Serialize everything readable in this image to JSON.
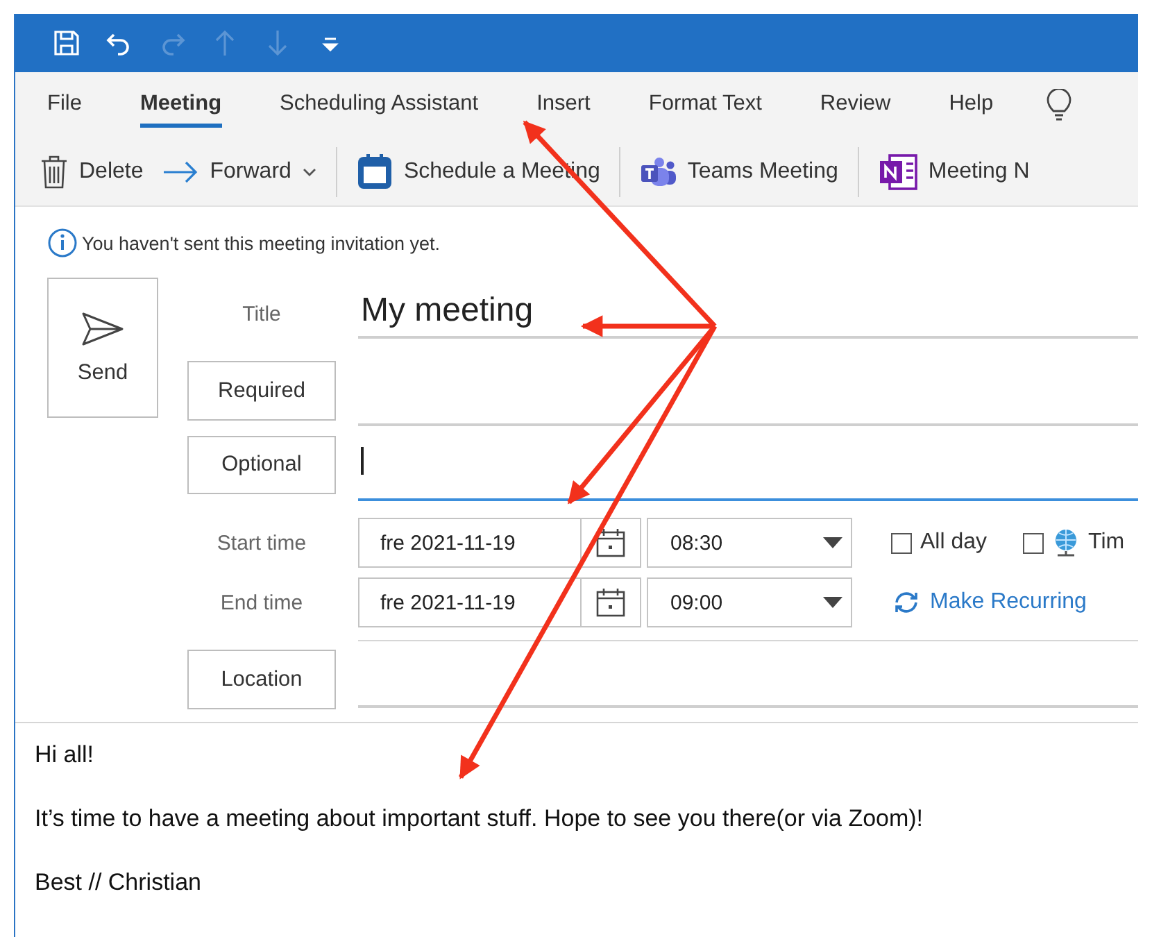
{
  "quick_access": [
    {
      "kind": "save",
      "disabled": false
    },
    {
      "kind": "undo",
      "disabled": false
    },
    {
      "kind": "redo",
      "disabled": true
    },
    {
      "kind": "up",
      "disabled": true
    },
    {
      "kind": "down",
      "disabled": true
    },
    {
      "kind": "customize",
      "disabled": false
    }
  ],
  "tabs": [
    {
      "label": "File",
      "selected": false
    },
    {
      "label": "Meeting",
      "selected": true
    },
    {
      "label": "Scheduling Assistant",
      "selected": false
    },
    {
      "label": "Insert",
      "selected": false
    },
    {
      "label": "Format Text",
      "selected": false
    },
    {
      "label": "Review",
      "selected": false
    },
    {
      "label": "Help",
      "selected": false
    }
  ],
  "commands": [
    {
      "kind": "delete",
      "label": "Delete",
      "dropdown": false
    },
    {
      "kind": "forward",
      "label": "Forward",
      "dropdown": true
    },
    {
      "kind": "schedule",
      "label": "Schedule a Meeting",
      "dropdown": false
    },
    {
      "kind": "teams",
      "label": "Teams Meeting",
      "dropdown": false
    },
    {
      "kind": "notes",
      "label": "Meeting N",
      "dropdown": false
    }
  ],
  "info_bar": {
    "text": "You haven't sent this meeting invitation yet."
  },
  "send_button": {
    "label": "Send"
  },
  "form": {
    "title": {
      "label": "Title",
      "value": "My meeting"
    },
    "required": {
      "label": "Required"
    },
    "optional": {
      "label": "Optional",
      "focused": true
    },
    "start": {
      "label": "Start time",
      "date": "fre 2021-11-19",
      "time": "08:30"
    },
    "end": {
      "label": "End time",
      "date": "fre 2021-11-19",
      "time": "09:00"
    },
    "all_day": {
      "label": "All day",
      "checked": false
    },
    "time_zones": {
      "label": "Tim",
      "checked": false
    },
    "recurring": {
      "label": "Make Recurring"
    },
    "location": {
      "label": "Location"
    }
  },
  "body": {
    "paragraphs": [
      "Hi all!",
      "It’s time to have a meeting about important stuff. Hope to see you there(or via Zoom)!",
      "Best // Christian"
    ]
  }
}
